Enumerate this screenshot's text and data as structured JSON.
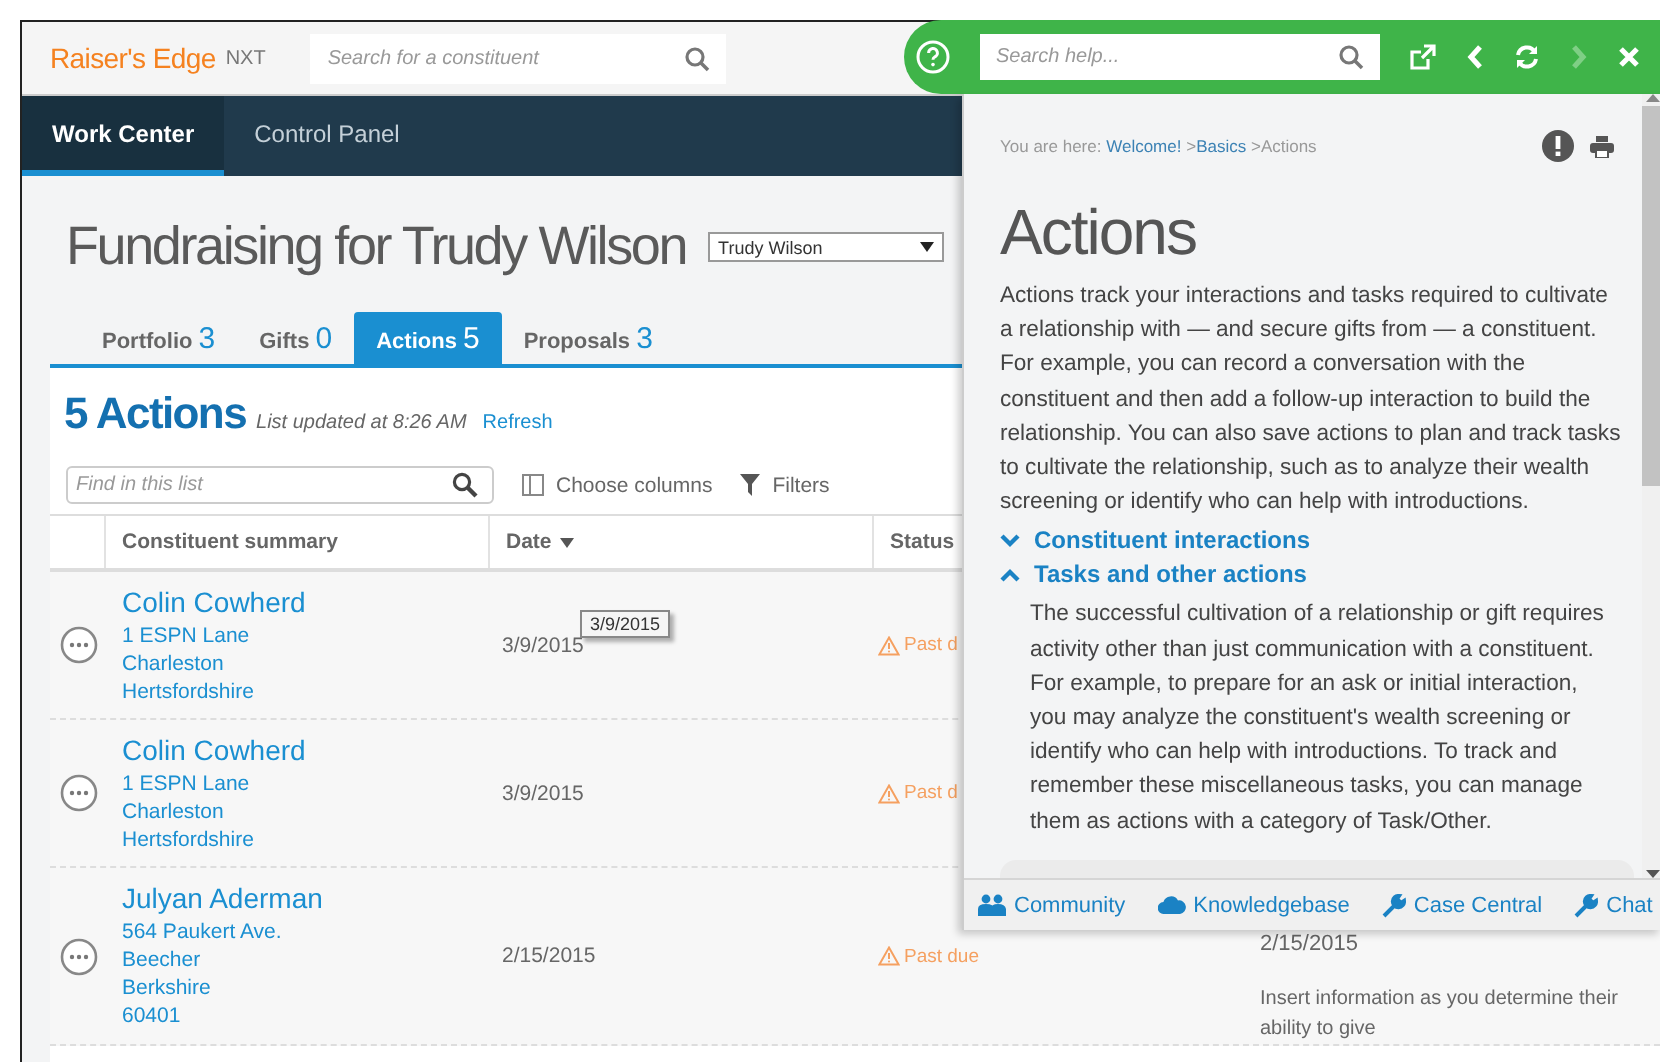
{
  "app": {
    "logo": "Raiser's Edge",
    "logo_suffix": "NXT",
    "search": {
      "placeholder": "Search for a constituent"
    }
  },
  "nav": [
    {
      "label": "Work Center",
      "selected": true
    },
    {
      "label": "Control Panel",
      "selected": false
    }
  ],
  "page": {
    "title": "Fundraising for Trudy Wilson",
    "person_select": "Trudy Wilson"
  },
  "tabs": [
    {
      "label": "Portfolio",
      "count": "3",
      "selected": false
    },
    {
      "label": "Gifts",
      "count": "0",
      "selected": false
    },
    {
      "label": "Actions",
      "count": "5",
      "selected": true
    },
    {
      "label": "Proposals",
      "count": "3",
      "selected": false
    }
  ],
  "list": {
    "count_title": "5 Actions",
    "updated": "List updated at 8:26 AM",
    "refresh": "Refresh",
    "find": {
      "placeholder": "Find in this list"
    },
    "choose_columns": "Choose columns",
    "filters": "Filters"
  },
  "table": {
    "columns": [
      {
        "label": "Constituent summary",
        "sorted": false
      },
      {
        "label": "Date",
        "sorted": true
      },
      {
        "label": "Status",
        "sorted": false
      }
    ],
    "rows": [
      {
        "name": "Colin Cowherd",
        "address": [
          "1 ESPN Lane",
          "Charleston",
          "Hertsfordshire"
        ],
        "date": "3/9/2015",
        "status": "Past d"
      },
      {
        "name": "Colin Cowherd",
        "address": [
          "1 ESPN Lane",
          "Charleston",
          "Hertsfordshire"
        ],
        "date": "3/9/2015",
        "status": "Past d"
      },
      {
        "name": "Julyan Aderman",
        "address": [
          "564 Paukert Ave.",
          "Beecher",
          "Berkshire",
          "60401"
        ],
        "date": "2/15/2015",
        "status": "Past due",
        "column_4": [
          "2/15/2015",
          "Insert information as you determine their ability to give"
        ]
      }
    ]
  },
  "tooltip": {
    "text": "3/9/2015"
  },
  "help": {
    "search": {
      "placeholder": "Search help..."
    },
    "buttons": [
      {
        "kind": "popout",
        "disabled": false
      },
      {
        "kind": "back",
        "disabled": false
      },
      {
        "kind": "refresh",
        "disabled": false
      },
      {
        "kind": "forward",
        "disabled": true
      },
      {
        "kind": "close",
        "disabled": false
      }
    ],
    "breadcrumb": {
      "prefix": "You are here:",
      "links": [
        "Welcome!",
        "Basics"
      ],
      "separator": ">",
      "current": "Actions"
    },
    "title": "Actions",
    "intro": "Actions track your interactions and tasks required to cultivate a relationship with — and secure gifts from — a constituent. For example, you can record a conversation with the constituent and then add a follow-up interaction to build the relationship. You can also save actions to plan and track tasks to cultivate the relationship, such as to analyze their wealth screening or identify who can help with introductions.",
    "sections": [
      {
        "title": "Constituent interactions",
        "expanded": false
      },
      {
        "title": "Tasks and other actions",
        "expanded": true,
        "body": "The successful cultivation of a relationship or gift requires activity other than just communication with a constituent. For example, to prepare for an ask or initial interaction, you may analyze the constituent's wealth screening or identify who can help with introductions. To track and remember these miscellaneous tasks, you can manage them as actions with a category of Task/Other."
      }
    ],
    "footer": [
      {
        "label": "Community",
        "kind": "people"
      },
      {
        "label": "Knowledgebase",
        "kind": "cloud"
      },
      {
        "label": "Case Central",
        "kind": "wrench"
      },
      {
        "label": "Chat",
        "kind": "wrench"
      }
    ]
  }
}
